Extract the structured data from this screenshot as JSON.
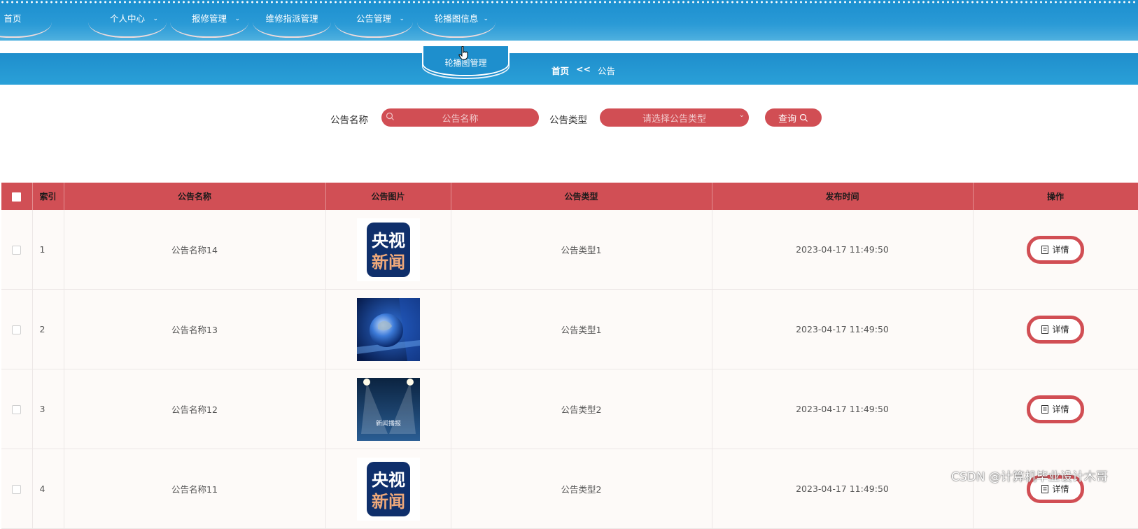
{
  "nav": {
    "items": [
      {
        "label": "首页",
        "has_dropdown": false
      },
      {
        "label": "个人中心",
        "has_dropdown": true
      },
      {
        "label": "报修管理",
        "has_dropdown": true
      },
      {
        "label": "维修指派管理",
        "has_dropdown": false
      },
      {
        "label": "公告管理",
        "has_dropdown": true
      },
      {
        "label": "轮播图信息",
        "has_dropdown": true
      }
    ],
    "dropdown_item": "轮播图管理"
  },
  "breadcrumb": {
    "home": "首页",
    "sep": "<<",
    "current": "公告"
  },
  "search": {
    "name_label": "公告名称",
    "name_placeholder": "公告名称",
    "type_label": "公告类型",
    "type_placeholder": "请选择公告类型",
    "query_button": "查询"
  },
  "table": {
    "columns": [
      "索引",
      "公告名称",
      "公告图片",
      "公告类型",
      "发布时间",
      "操作"
    ],
    "rows": [
      {
        "index": "1",
        "name": "公告名称14",
        "image": "cctv-news-logo",
        "type": "公告类型1",
        "time": "2023-04-17 11:49:50",
        "action": "详情"
      },
      {
        "index": "2",
        "name": "公告名称13",
        "image": "globe-news-studio",
        "type": "公告类型1",
        "time": "2023-04-17 11:49:50",
        "action": "详情"
      },
      {
        "index": "3",
        "name": "公告名称12",
        "image": "stage-news-report",
        "type": "公告类型2",
        "time": "2023-04-17 11:49:50",
        "action": "详情"
      },
      {
        "index": "4",
        "name": "公告名称11",
        "image": "cctv-news-logo",
        "type": "公告类型2",
        "time": "2023-04-17 11:49:50",
        "action": "详情"
      }
    ]
  },
  "images": {
    "cctv_line1": "央视",
    "cctv_line2": "新闻",
    "stage_caption": "新闻播报"
  },
  "watermark": "CSDN @计算机毕业设计木哥",
  "colors": {
    "nav_blue": "#1f8ecc",
    "accent_red": "#d14e54"
  }
}
